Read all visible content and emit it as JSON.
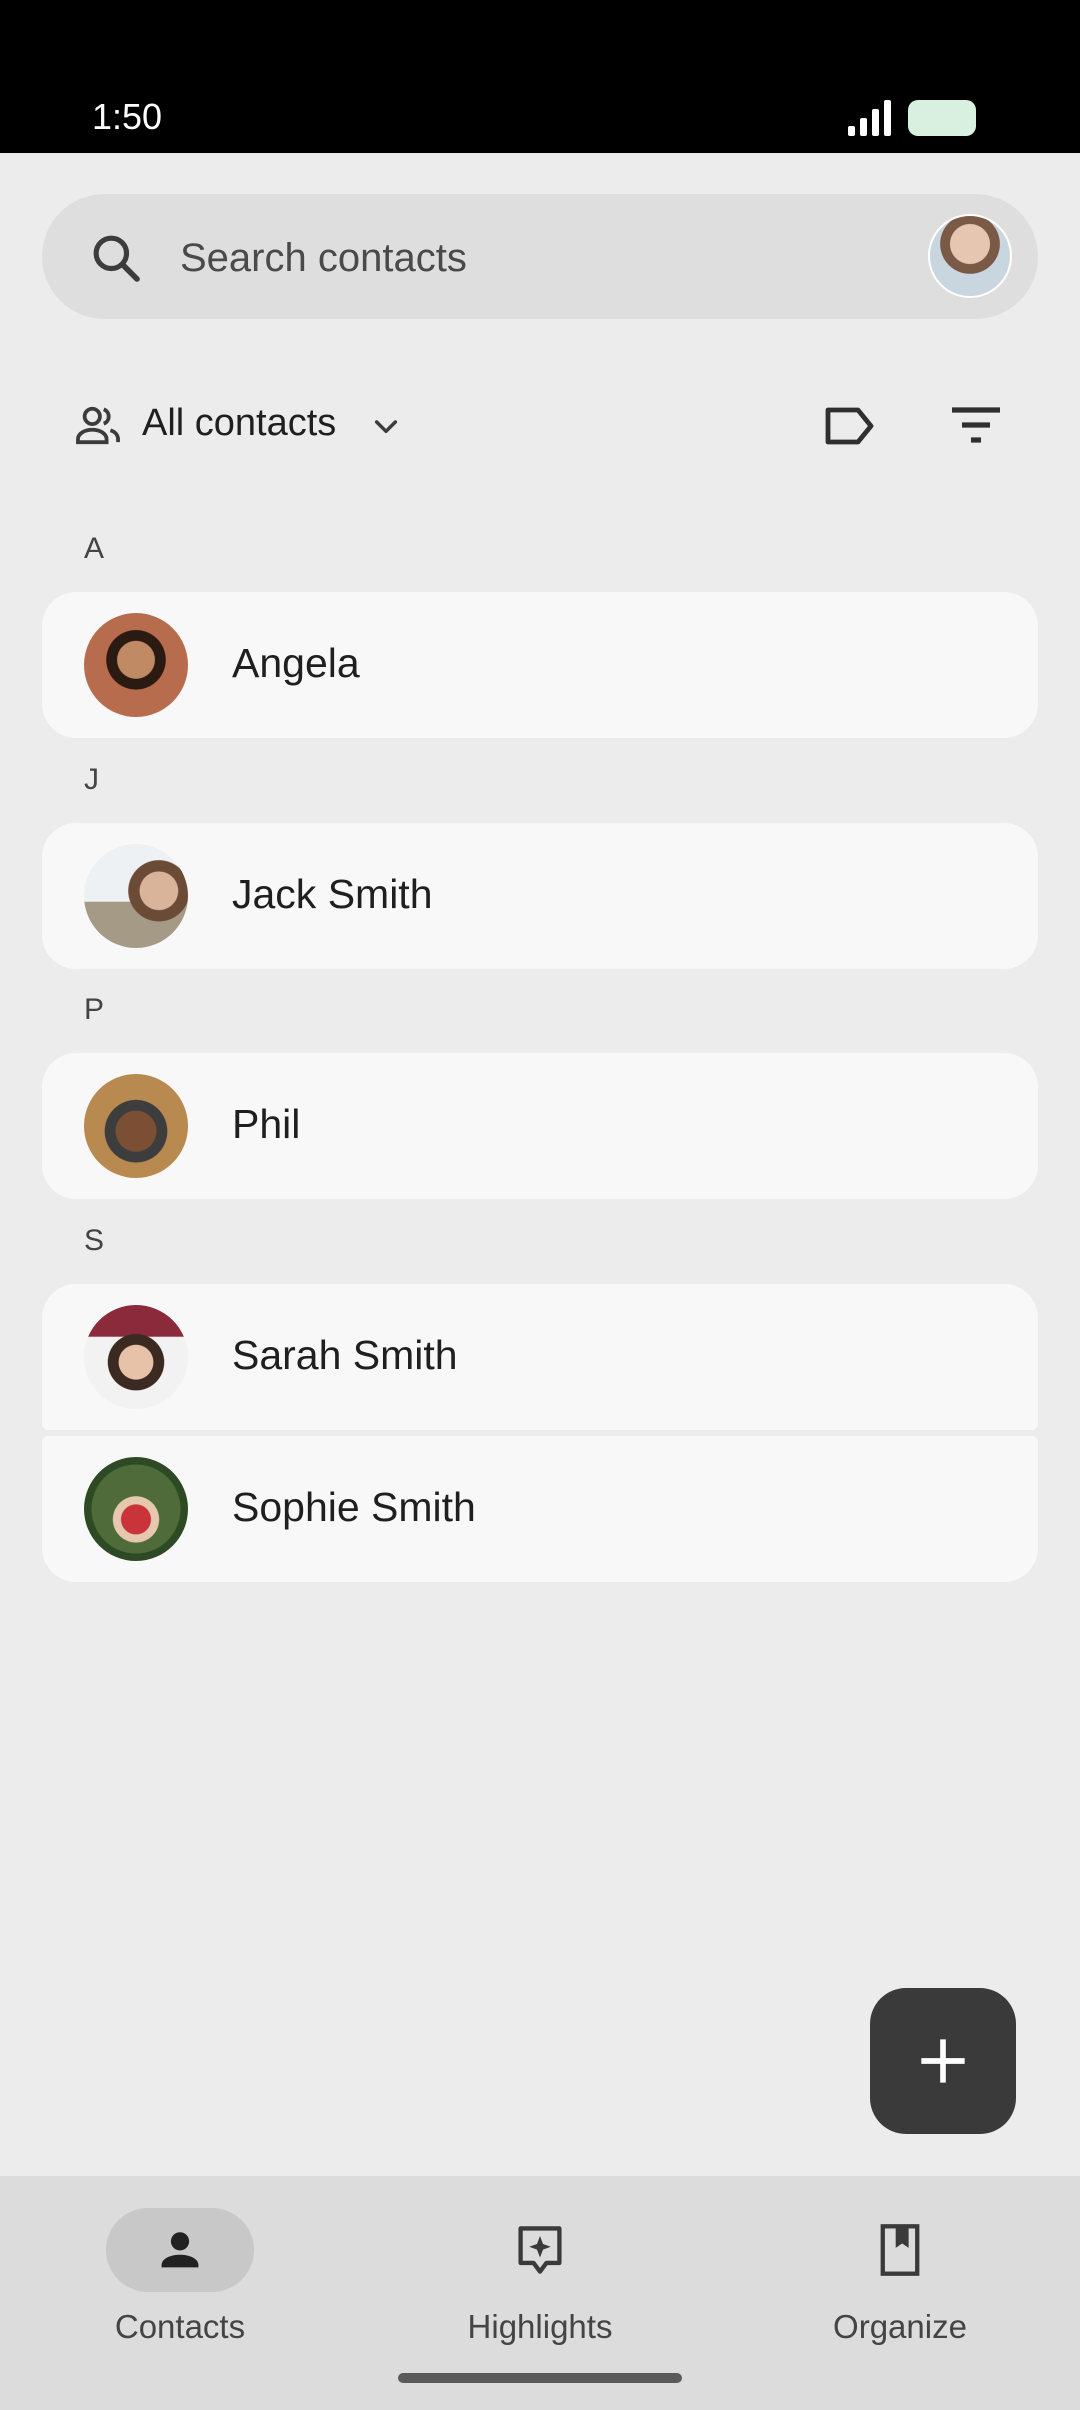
{
  "status_bar": {
    "time": "1:50"
  },
  "search": {
    "placeholder": "Search contacts"
  },
  "filter": {
    "label": "All contacts"
  },
  "sections": [
    {
      "letter": "A",
      "contacts": [
        "Angela"
      ]
    },
    {
      "letter": "J",
      "contacts": [
        "Jack Smith"
      ]
    },
    {
      "letter": "P",
      "contacts": [
        "Phil"
      ]
    },
    {
      "letter": "S",
      "contacts": [
        "Sarah Smith",
        "Sophie Smith"
      ]
    }
  ],
  "bottom_nav": {
    "items": [
      {
        "label": "Contacts",
        "icon": "person-icon",
        "active": true
      },
      {
        "label": "Highlights",
        "icon": "highlights-icon",
        "active": false
      },
      {
        "label": "Organize",
        "icon": "bookmark-icon",
        "active": false
      }
    ]
  },
  "colors": {
    "background": "#ececec",
    "card": "#f8f8f8",
    "fab": "#3a3a3a",
    "nav_background": "#dcdcdc"
  }
}
